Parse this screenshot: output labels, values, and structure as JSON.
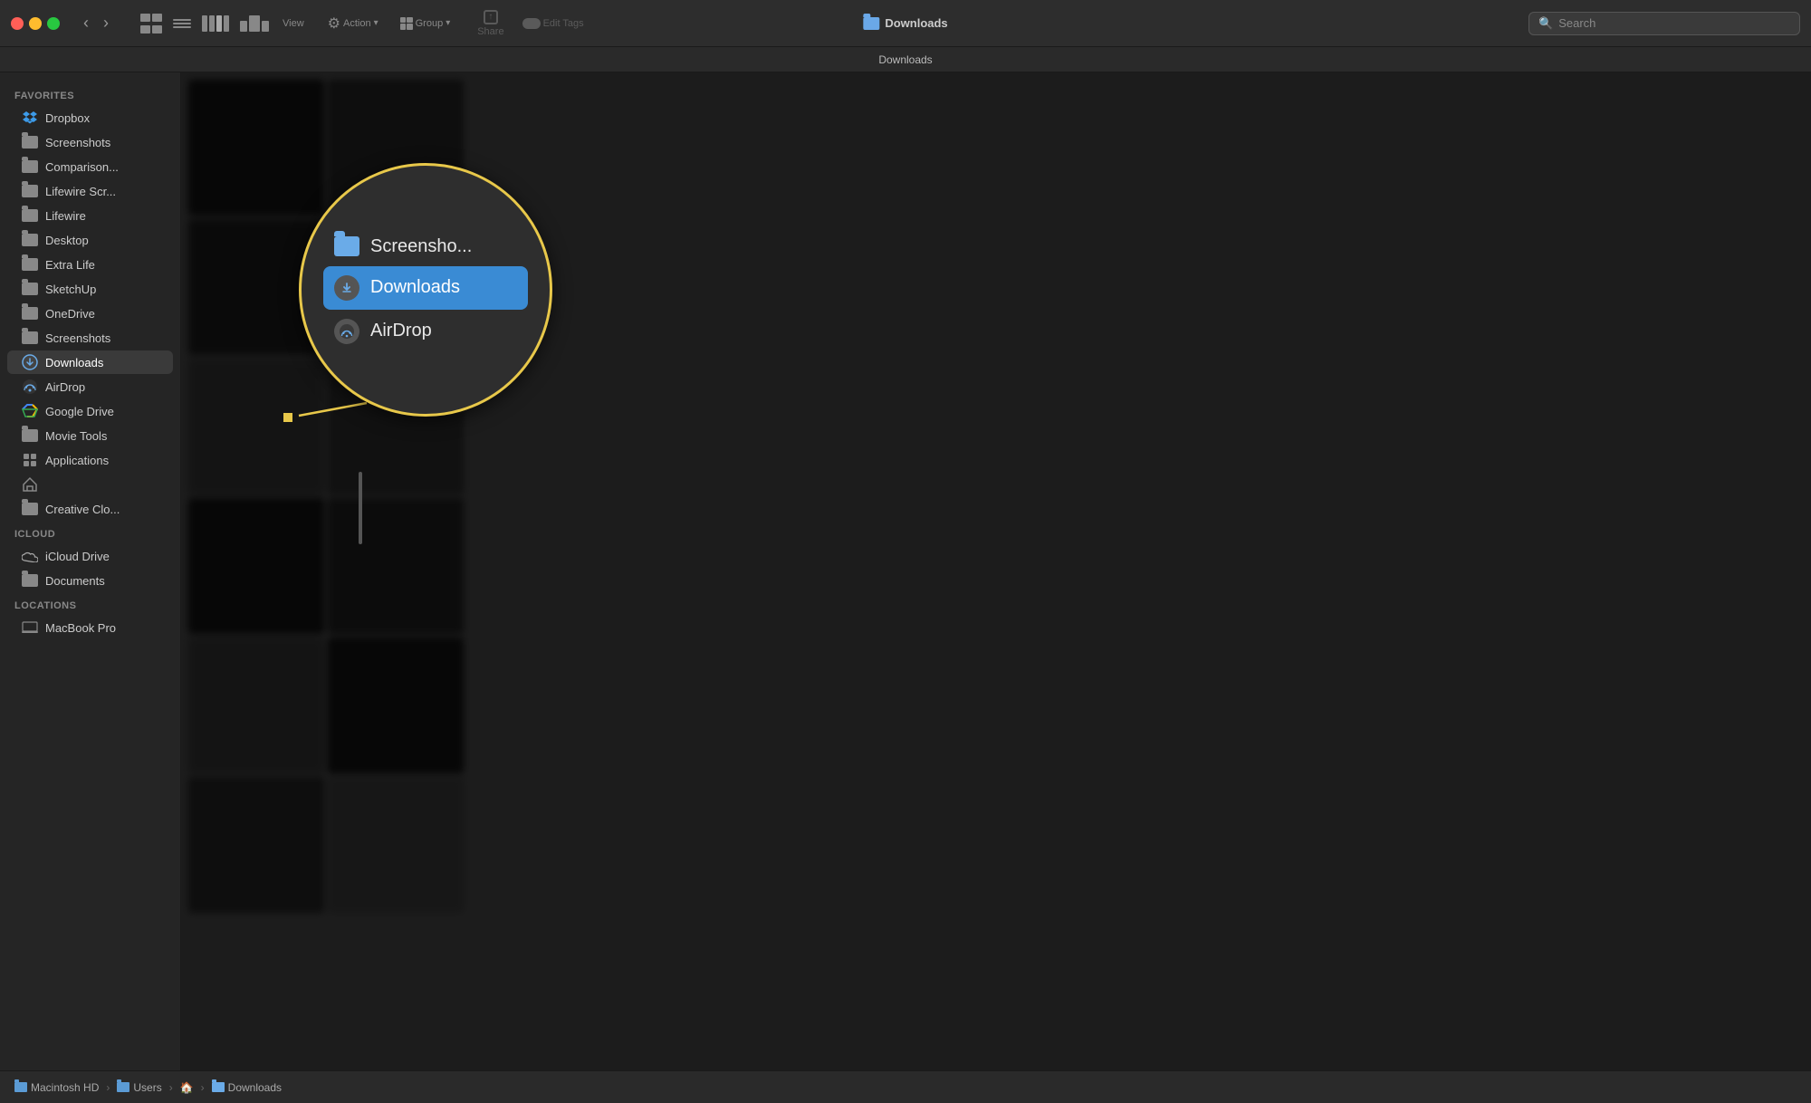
{
  "window": {
    "title": "Downloads",
    "title_with_icon": "📁 Downloads"
  },
  "traffic_lights": {
    "close": "close",
    "minimize": "minimize",
    "maximize": "maximize"
  },
  "toolbar": {
    "back_label": "‹",
    "forward_label": "›",
    "nav_label": "Back/Forward",
    "view_label": "View",
    "action_label": "Action",
    "group_label": "Group",
    "share_label": "Share",
    "edit_tags_label": "Edit Tags",
    "search_placeholder": "Search",
    "search_label": "Search"
  },
  "pathbar": {
    "text": "Downloads"
  },
  "sidebar": {
    "favorites_header": "Favorites",
    "icloud_header": "iCloud",
    "locations_header": "Locations",
    "items": [
      {
        "id": "dropbox",
        "label": "Dropbox",
        "icon": "dropbox-icon"
      },
      {
        "id": "screenshots",
        "label": "Screenshots",
        "icon": "folder-icon"
      },
      {
        "id": "comparison",
        "label": "Comparison...",
        "icon": "folder-icon"
      },
      {
        "id": "lifewire-scr",
        "label": "Lifewire Scr...",
        "icon": "folder-icon"
      },
      {
        "id": "lifewire",
        "label": "Lifewire",
        "icon": "folder-icon"
      },
      {
        "id": "desktop",
        "label": "Desktop",
        "icon": "folder-icon"
      },
      {
        "id": "extra-life",
        "label": "Extra Life",
        "icon": "folder-icon"
      },
      {
        "id": "sketchup",
        "label": "SketchUp",
        "icon": "folder-icon"
      },
      {
        "id": "onedrive",
        "label": "OneDrive",
        "icon": "folder-icon"
      },
      {
        "id": "screenshots2",
        "label": "Screenshots",
        "icon": "folder-icon"
      },
      {
        "id": "downloads",
        "label": "Downloads",
        "icon": "download-icon",
        "active": true
      },
      {
        "id": "airdrop",
        "label": "AirDrop",
        "icon": "airdrop-icon"
      },
      {
        "id": "google-drive",
        "label": "Google Drive",
        "icon": "gdrive-icon"
      },
      {
        "id": "movie-tools",
        "label": "Movie Tools",
        "icon": "folder-icon"
      },
      {
        "id": "applications",
        "label": "Applications",
        "icon": "apps-icon"
      },
      {
        "id": "home",
        "label": "",
        "icon": "home-icon"
      },
      {
        "id": "creative-cloud",
        "label": "Creative Clo...",
        "icon": "folder-icon"
      }
    ],
    "icloud_items": [
      {
        "id": "icloud-drive",
        "label": "iCloud Drive",
        "icon": "icloud-icon"
      },
      {
        "id": "documents",
        "label": "Documents",
        "icon": "folder-icon"
      }
    ],
    "locations_items": [
      {
        "id": "macbook-pro",
        "label": "MacBook Pro",
        "icon": "laptop-icon"
      }
    ]
  },
  "magnifier": {
    "items": [
      {
        "label": "Screensho...",
        "type": "folder"
      },
      {
        "label": "Downloads",
        "type": "download",
        "highlighted": true
      },
      {
        "label": "AirDrop",
        "type": "airdrop"
      }
    ]
  },
  "breadcrumb": {
    "parts": [
      {
        "label": "Macintosh HD",
        "icon": "hd-icon"
      },
      {
        "label": "Users",
        "icon": "folder-icon"
      },
      {
        "label": "👤",
        "icon": "user-icon"
      },
      {
        "label": "Downloads",
        "icon": "folder-icon"
      }
    ]
  },
  "colors": {
    "accent_blue": "#5b9bd5",
    "highlight_yellow": "#e8c84a",
    "active_blue": "#3a8bd4",
    "bg_dark": "#1c1c1c",
    "sidebar_bg": "#252525",
    "toolbar_bg": "#2d2d2d"
  }
}
